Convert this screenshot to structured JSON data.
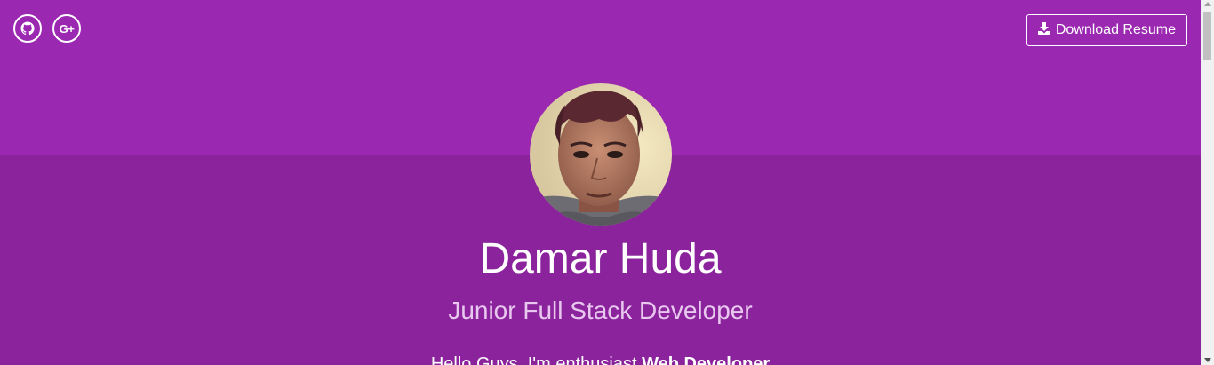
{
  "header": {
    "social_links": [
      {
        "icon": "github-icon",
        "label": "GitHub"
      },
      {
        "icon": "google-plus-icon",
        "glyph": "G+"
      }
    ],
    "download_button": {
      "label": "Download Resume",
      "icon": "download-icon"
    }
  },
  "profile": {
    "name": "Damar Huda",
    "role": "Junior Full Stack Developer",
    "intro_prefix": "Hello Guys, I'm enthusiast ",
    "intro_highlight": "Web Developer"
  },
  "colors": {
    "top_band": "#9b28b0",
    "main_bg": "#8b249c",
    "text": "#ffffff",
    "role_text": "#e9c8ef"
  }
}
